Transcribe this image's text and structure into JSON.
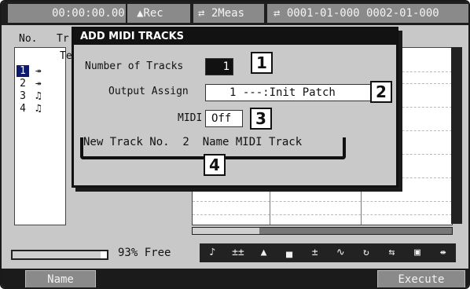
{
  "status_bar": {
    "time": "00:00:00.00",
    "rec_mode": "▲Rec",
    "loop_icon": "loop-arrows-icon",
    "loop_text": "⇄ 2Meas",
    "locators": "⇄ 0001-01-000  0002-01-000"
  },
  "track_list": {
    "header_no": "No.",
    "header_track": "Tr",
    "header_tempo": "Te",
    "tracks": [
      {
        "num": "1",
        "icon": "↠",
        "icon_name": "tempo-track-icon"
      },
      {
        "num": "2",
        "icon": "↠",
        "icon_name": "tempo-track-icon"
      },
      {
        "num": "3",
        "icon": "♫",
        "icon_name": "midi-note-icon"
      },
      {
        "num": "4",
        "icon": "♫",
        "icon_name": "midi-note-icon"
      }
    ],
    "selected_track": 1
  },
  "memory": {
    "free_text": "93% Free",
    "free_fraction": 0.93
  },
  "tools": [
    {
      "glyph": "♪",
      "name": "note-tool-icon"
    },
    {
      "glyph": "±±",
      "name": "velocity-tool-icon"
    },
    {
      "glyph": "▲",
      "name": "accent-tool-icon"
    },
    {
      "glyph": "▄",
      "name": "gate-tool-icon"
    },
    {
      "glyph": "±",
      "name": "transpose-tool-icon"
    },
    {
      "glyph": "∿",
      "name": "curve-tool-icon"
    },
    {
      "glyph": "↻",
      "name": "loop-tool-icon"
    },
    {
      "glyph": "⇆",
      "name": "swap-tool-icon"
    },
    {
      "glyph": "▣",
      "name": "grid-tool-icon"
    },
    {
      "glyph": "⇼",
      "name": "zoom-tool-icon"
    }
  ],
  "function_buttons": {
    "left": "Name",
    "right": "Execute"
  },
  "dialog": {
    "title": "ADD MIDI TRACKS",
    "number_of_tracks_label": "Number of Tracks",
    "number_of_tracks_value": "1",
    "output_assign_label": "Output Assign",
    "output_assign_value": "1 ---:Init Patch",
    "midi_label": "MIDI",
    "midi_value": "Off",
    "new_track_text": "New Track No.  2  Name MIDI Track",
    "callouts": [
      "1",
      "2",
      "3",
      "4"
    ]
  }
}
